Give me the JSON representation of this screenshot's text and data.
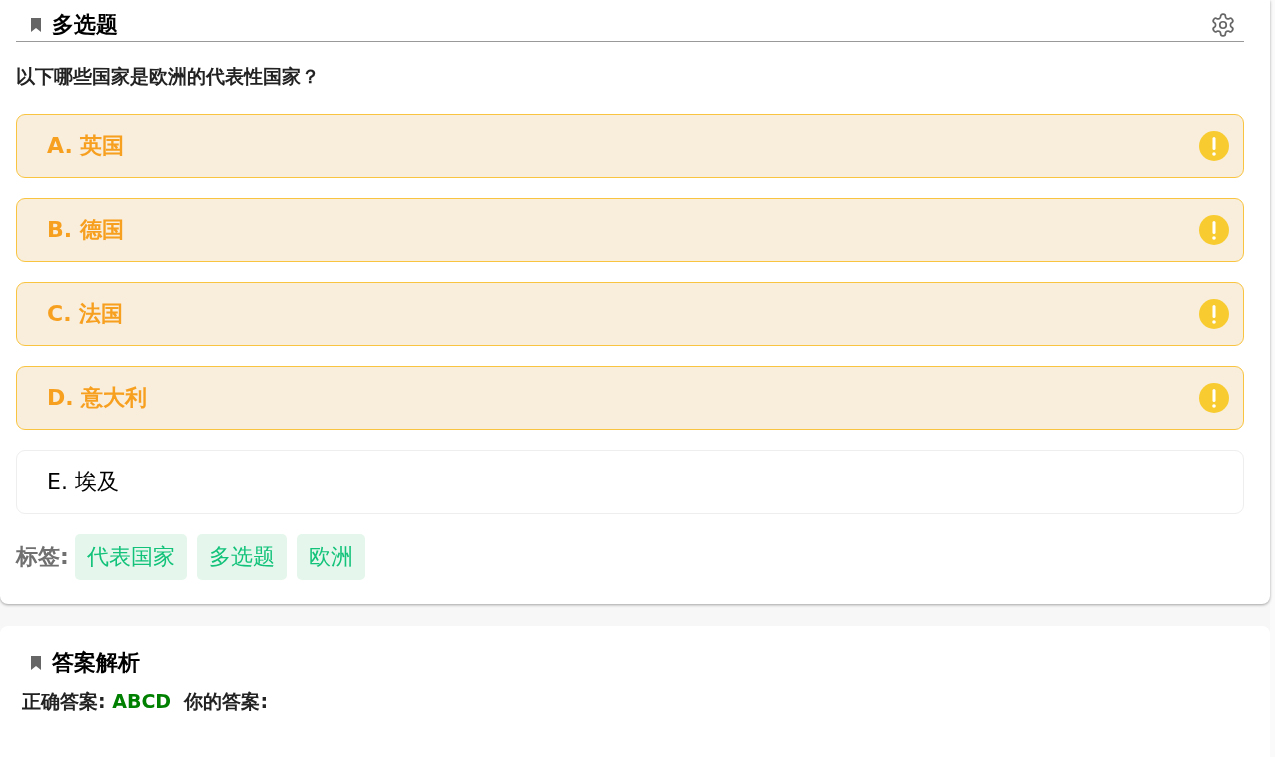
{
  "question": {
    "type_title": "多选题",
    "text": "以下哪些国家是欧洲的代表性国家？",
    "options": [
      {
        "label": "A. 英国",
        "flagged": true
      },
      {
        "label": "B. 德国",
        "flagged": true
      },
      {
        "label": "C. 法国",
        "flagged": true
      },
      {
        "label": "D. 意大利",
        "flagged": true
      },
      {
        "label": "E. 埃及",
        "flagged": false
      }
    ],
    "tags_label": "标签:",
    "tags": [
      "代表国家",
      "多选题",
      "欧洲"
    ]
  },
  "analysis": {
    "title": "答案解析",
    "correct_label": "正确答案:",
    "correct_value": "ABCD",
    "your_label": "你的答案:"
  }
}
